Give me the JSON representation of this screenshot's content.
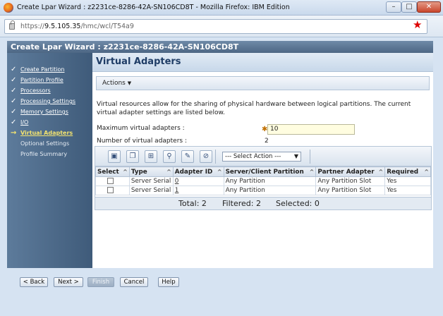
{
  "window": {
    "title": "Create Lpar Wizard : z2231ce-8286-42A-SN106CD8T - Mozilla Firefox: IBM Edition",
    "min_label": "–",
    "max_label": "□",
    "close_label": "✕"
  },
  "address": {
    "scheme": "https://",
    "host": "9.5.105.35",
    "path": "/hmc/wcl/T54a9"
  },
  "wizard": {
    "header": "Create Lpar Wizard : z2231ce-8286-42A-SN106CD8T",
    "steps": [
      {
        "label": "Create Partition",
        "status": "done"
      },
      {
        "label": "Partition Profile",
        "status": "done"
      },
      {
        "label": "Processors",
        "status": "done"
      },
      {
        "label": "Processing Settings",
        "status": "done"
      },
      {
        "label": "Memory Settings",
        "status": "done"
      },
      {
        "label": "I/O",
        "status": "done"
      },
      {
        "label": "Virtual Adapters",
        "status": "current"
      },
      {
        "label": "Optional Settings",
        "status": "todo"
      },
      {
        "label": "Profile Summary",
        "status": "todo"
      }
    ]
  },
  "main": {
    "title": "Virtual Adapters",
    "actions_label": "Actions",
    "description": "Virtual resources allow for the sharing of physical hardware between logical partitions. The current virtual adapter settings are listed below.",
    "max_label": "Maximum virtual adapters :",
    "max_value": "10",
    "num_label": "Number of virtual adapters :",
    "num_value": "2",
    "select_action": "--- Select Action ---"
  },
  "table": {
    "columns": [
      "Select",
      "Type",
      "Adapter ID",
      "Server/Client Partition",
      "Partner Adapter",
      "Required"
    ],
    "rows": [
      {
        "type": "Server Serial",
        "adapter_id": "0",
        "partition": "Any Partition",
        "partner": "Any Partition Slot",
        "required": "Yes"
      },
      {
        "type": "Server Serial",
        "adapter_id": "1",
        "partition": "Any Partition",
        "partner": "Any Partition Slot",
        "required": "Yes"
      }
    ],
    "summary": {
      "total": "Total: 2",
      "filtered": "Filtered: 2",
      "selected": "Selected: 0"
    }
  },
  "buttons": {
    "back": "< Back",
    "next": "Next >",
    "finish": "Finish",
    "cancel": "Cancel",
    "help": "Help"
  },
  "icons": {
    "toolbar": [
      "select-all-icon",
      "deselect-all-icon",
      "filter-icon",
      "edit-filter-icon",
      "sort-icon",
      "clear-sort-icon"
    ]
  },
  "colors": {
    "nav_bg": "#4d6a8a",
    "current_step": "#f3e36f",
    "title_text": "#1f3d66",
    "star": "#dd0000"
  }
}
